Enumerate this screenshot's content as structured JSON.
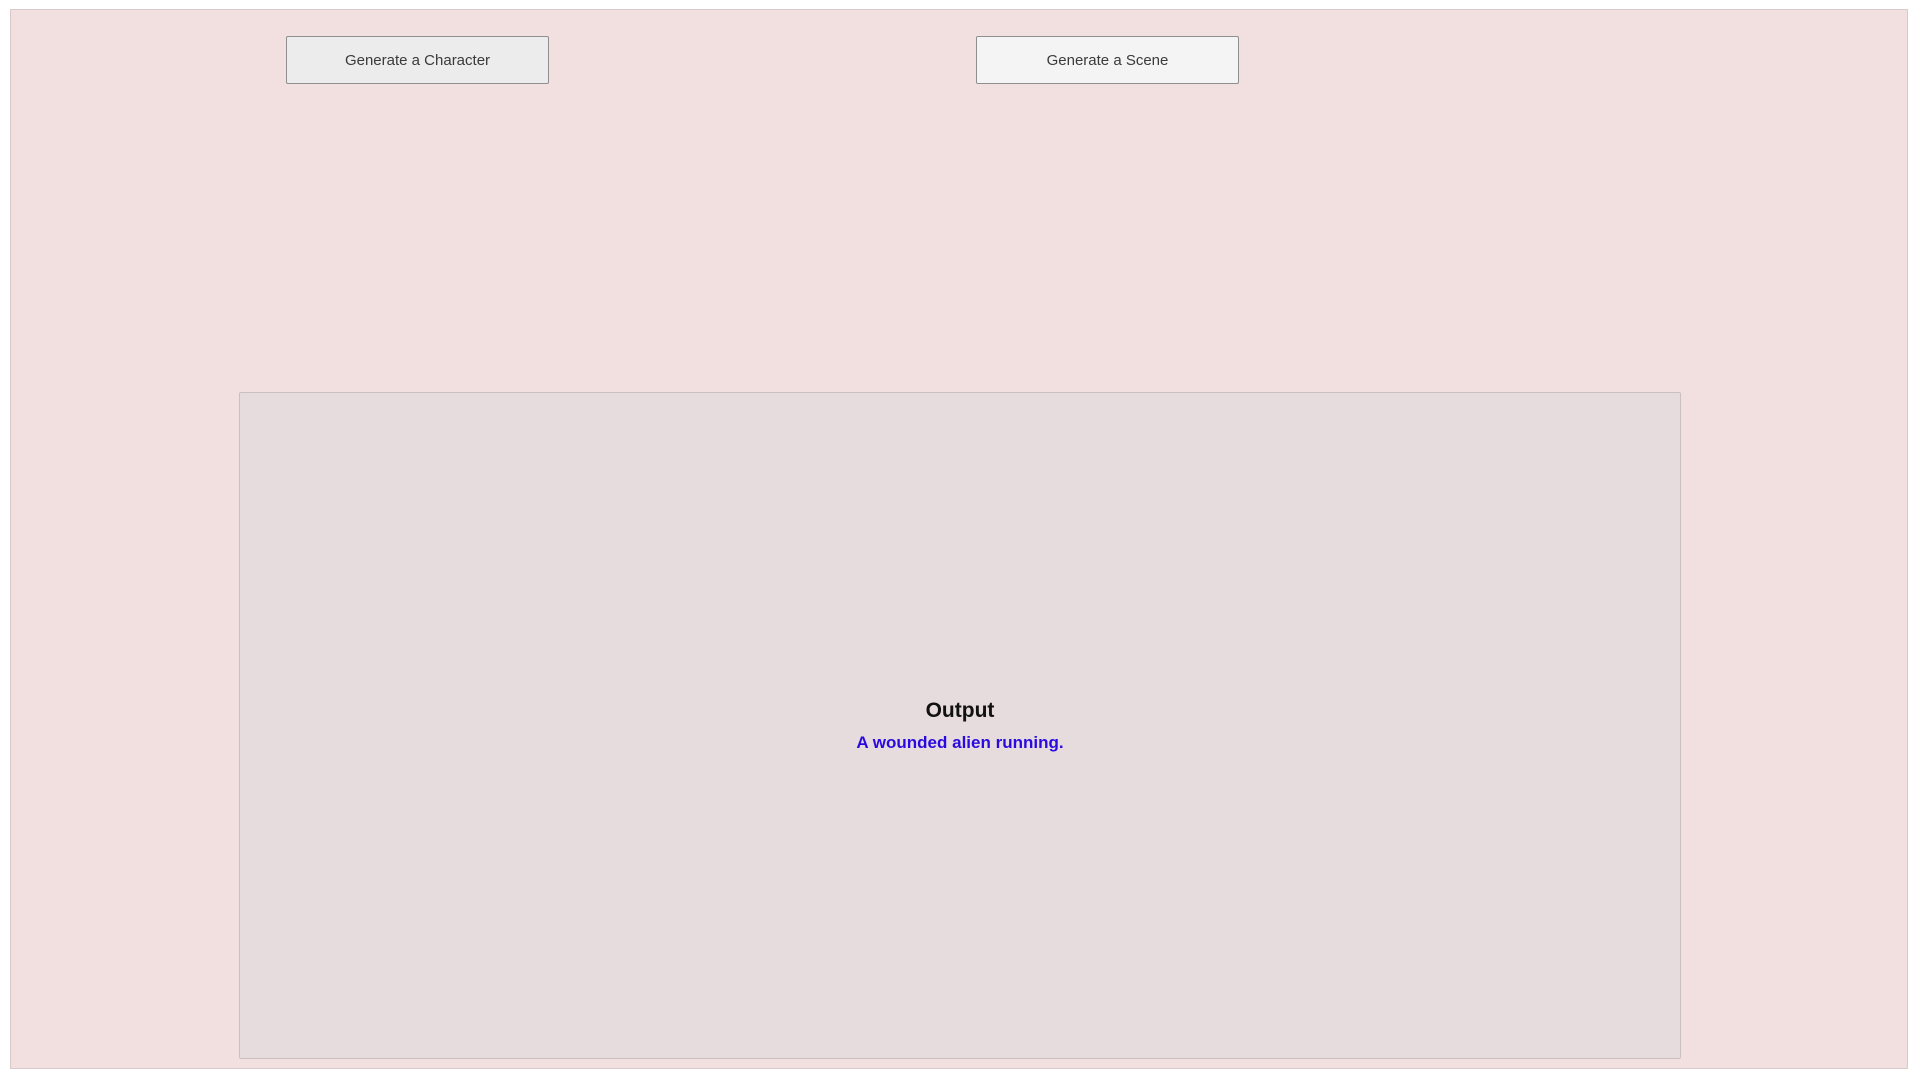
{
  "controls": {
    "character_button_label": "Generate a Character",
    "scene_button_label": "Generate a Scene"
  },
  "output": {
    "heading": "Output",
    "result_text": "A wounded alien running."
  },
  "colors": {
    "app_background": "#f2e0e1",
    "output_panel_background": "#e7dcdd",
    "result_text_color": "#2a0ae0"
  }
}
